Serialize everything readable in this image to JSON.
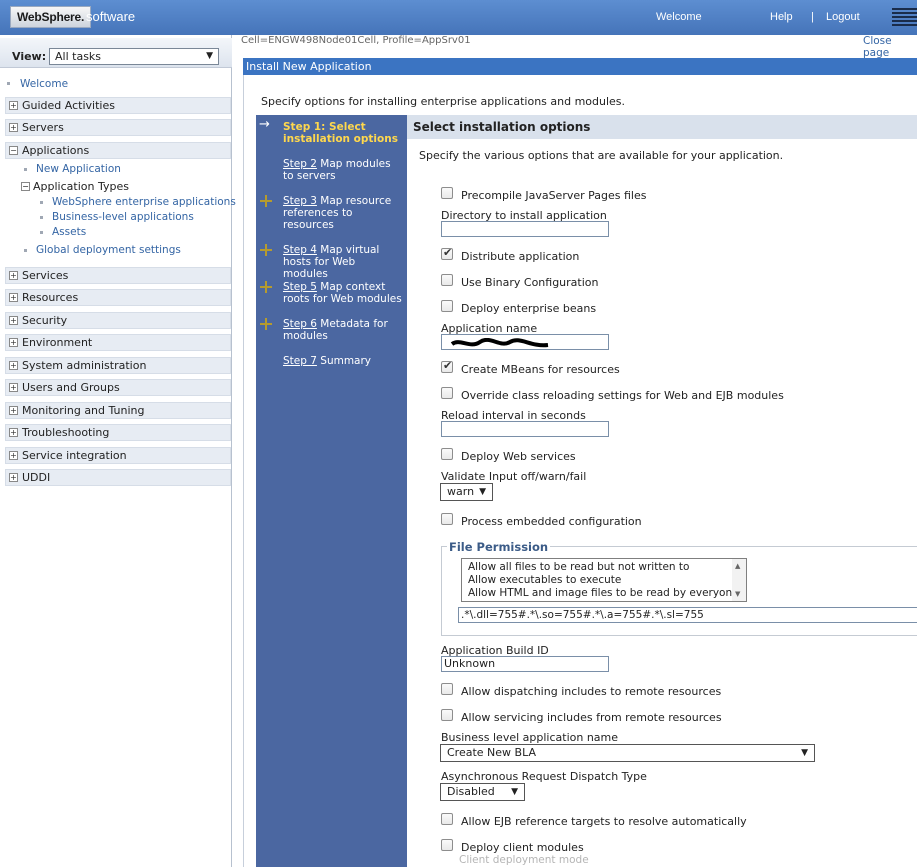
{
  "banner": {
    "brand": "WebSphere.",
    "brand_suffix": "software",
    "welcome": "Welcome",
    "help": "Help",
    "separator": "|",
    "logout": "Logout",
    "ibm": "IBM"
  },
  "leftnav": {
    "view_label": "View:",
    "view_value": "All tasks",
    "welcome": "Welcome",
    "groups": {
      "guided": "Guided Activities",
      "servers": "Servers",
      "applications": "Applications",
      "services": "Services",
      "resources": "Resources",
      "security": "Security",
      "environment": "Environment",
      "sysadmin": "System administration",
      "users": "Users and Groups",
      "monitoring": "Monitoring and Tuning",
      "troubleshooting": "Troubleshooting",
      "service_integration": "Service integration",
      "uddi": "UDDI"
    },
    "apps": {
      "new_application": "New Application",
      "application_types": "Application Types",
      "enterprise": "WebSphere enterprise applications",
      "business_level": "Business-level applications",
      "assets": "Assets",
      "global_deployment": "Global deployment settings"
    }
  },
  "main": {
    "crumb": "Cell=ENGW498Node01Cell, Profile=AppSrv01",
    "close_page": "Close page",
    "title": "Install New Application",
    "intro": "Specify options for installing enterprise applications and modules."
  },
  "steps": {
    "s1": "Step 1: Select installation options",
    "s2_link": "Step 2",
    "s2_text": " Map modules to servers",
    "s3_link": "Step 3",
    "s3_text": " Map resource references to resources",
    "s4_link": "Step 4",
    "s4_text": " Map virtual hosts for Web modules",
    "s5_link": "Step 5",
    "s5_text": " Map context roots for Web modules",
    "s6_link": "Step 6",
    "s6_text": " Metadata for modules",
    "s7_link": "Step 7",
    "s7_text": " Summary"
  },
  "form": {
    "heading": "Select installation options",
    "description": "Specify the various options that are available for your application.",
    "precompile": "Precompile JavaServer Pages files",
    "directory_label": "Directory to install application",
    "directory_value": "",
    "distribute": "Distribute application",
    "binary_config": "Use Binary Configuration",
    "deploy_ejb": "Deploy enterprise beans",
    "app_name_label": "Application name",
    "create_mbeans": "Create MBeans for resources",
    "override_reload": "Override class reloading settings for Web and EJB modules",
    "reload_label": "Reload interval in seconds",
    "reload_value": "",
    "deploy_ws": "Deploy Web services",
    "validate_label": "Validate Input off/warn/fail",
    "validate_value": "warn",
    "process_embedded": "Process embedded configuration",
    "file_permission": {
      "legend": "File Permission",
      "options": [
        "Allow all files to be read but not written to",
        "Allow executables to execute",
        "Allow HTML and image files to be read by everyone"
      ],
      "value": ".*\\.dll=755#.*\\.so=755#.*\\.a=755#.*\\.sl=755"
    },
    "build_id_label": "Application Build ID",
    "build_id_value": "Unknown",
    "allow_dispatching": "Allow dispatching includes to remote resources",
    "allow_servicing": "Allow servicing includes from remote resources",
    "bla_label": "Business level application name",
    "bla_value": "Create New BLA",
    "async_label": "Asynchronous Request Dispatch Type",
    "async_value": "Disabled",
    "allow_ejb_ref": "Allow EJB reference targets to resolve automatically",
    "deploy_client": "Deploy client modules",
    "client_mode": "Client deployment mode"
  },
  "colors": {
    "banner": "#4a7bc0",
    "steps_panel": "#4b67a1",
    "current_step": "#ffd84d",
    "link": "#3465a4",
    "titlebar": "#3b74c2"
  }
}
